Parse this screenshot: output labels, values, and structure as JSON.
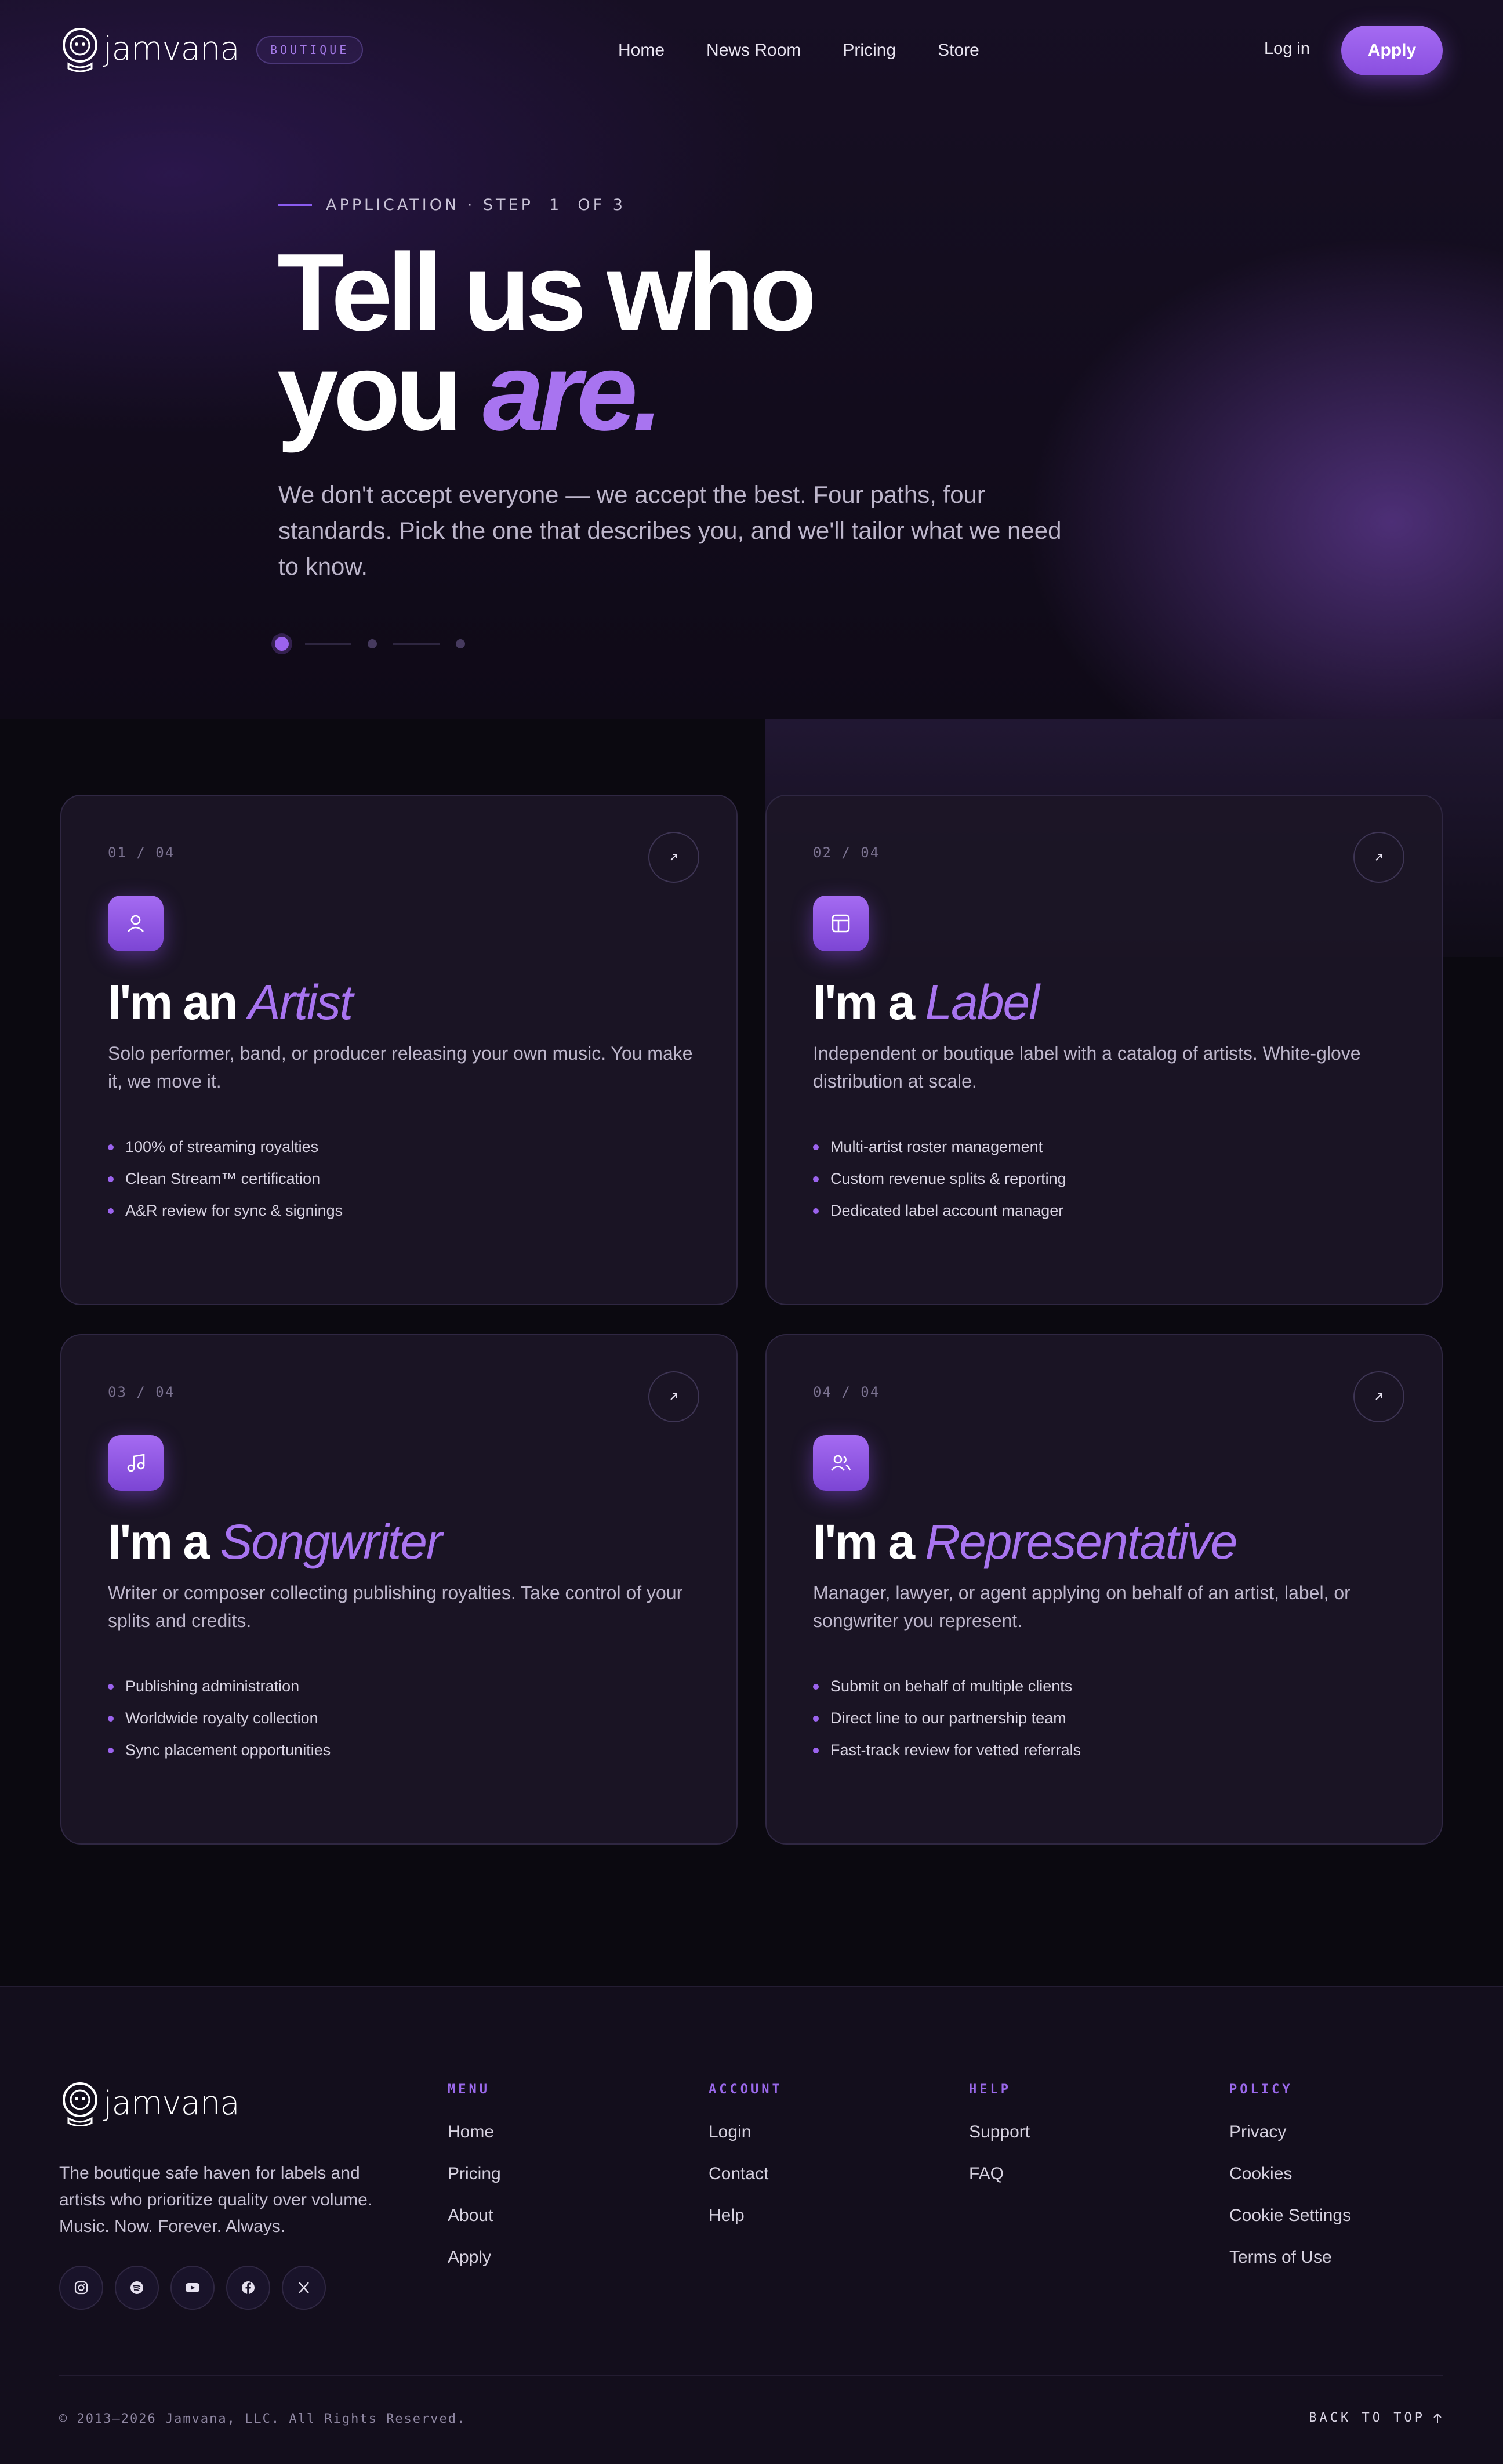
{
  "header": {
    "brand": "jamvana",
    "badge": "BOUTIQUE",
    "nav": [
      "Home",
      "News Room",
      "Pricing",
      "Store"
    ],
    "login": "Log in",
    "apply": "Apply"
  },
  "hero": {
    "eyebrow": "APPLICATION · STEP  1  OF 3",
    "title_line1": "Tell us who",
    "title_line2_plain": "you ",
    "title_line2_accent": "are.",
    "subtitle": "We don't accept everyone — we accept the best. Four paths, four standards. Pick the one that describes you, and we'll tailor what we need to know.",
    "steps": {
      "current": 1,
      "total": 3
    }
  },
  "cards": [
    {
      "num": "01 / 04",
      "icon": "user-icon",
      "title_plain": "I'm an ",
      "title_accent": "Artist",
      "desc": "Solo performer, band, or producer releasing your own music. You make it, we move it.",
      "features": [
        "100% of streaming royalties",
        "Clean Stream™ certification",
        "A&R review for sync & signings"
      ]
    },
    {
      "num": "02 / 04",
      "icon": "layout-icon",
      "title_plain": "I'm a ",
      "title_accent": "Label",
      "desc": "Independent or boutique label with a catalog of artists. White-glove distribution at scale.",
      "features": [
        "Multi-artist roster management",
        "Custom revenue splits & reporting",
        "Dedicated label account manager"
      ]
    },
    {
      "num": "03 / 04",
      "icon": "music-note-icon",
      "title_plain": "I'm a ",
      "title_accent": "Songwriter",
      "desc": "Writer or composer collecting publishing royalties. Take control of your splits and credits.",
      "features": [
        "Publishing administration",
        "Worldwide royalty collection",
        "Sync placement opportunities"
      ]
    },
    {
      "num": "04 / 04",
      "icon": "users-icon",
      "title_plain": "I'm a ",
      "title_accent": "Representative",
      "desc": "Manager, lawyer, or agent applying on behalf of an artist, label, or songwriter you represent.",
      "features": [
        "Submit on behalf of multiple clients",
        "Direct line to our partnership team",
        "Fast-track review for vetted referrals"
      ]
    }
  ],
  "footer": {
    "brand": "jamvana",
    "tagline": "The boutique safe haven for labels and artists who prioritize quality over volume. Music. Now. Forever. Always.",
    "socials": [
      "instagram-icon",
      "spotify-icon",
      "youtube-icon",
      "facebook-icon",
      "x-icon"
    ],
    "columns": [
      {
        "heading": "MENU",
        "links": [
          "Home",
          "Pricing",
          "About",
          "Apply"
        ]
      },
      {
        "heading": "ACCOUNT",
        "links": [
          "Login",
          "Contact",
          "Help"
        ]
      },
      {
        "heading": "HELP",
        "links": [
          "Support",
          "FAQ"
        ]
      },
      {
        "heading": "POLICY",
        "links": [
          "Privacy",
          "Cookies",
          "Cookie Settings",
          "Terms of Use"
        ]
      }
    ],
    "copyright": "© 2013–2026 Jamvana, LLC. All Rights Reserved.",
    "back_to_top": "BACK TO TOP"
  },
  "colors": {
    "accent": "#a874f0",
    "background": "#0b0910",
    "card": "#1c1626"
  }
}
